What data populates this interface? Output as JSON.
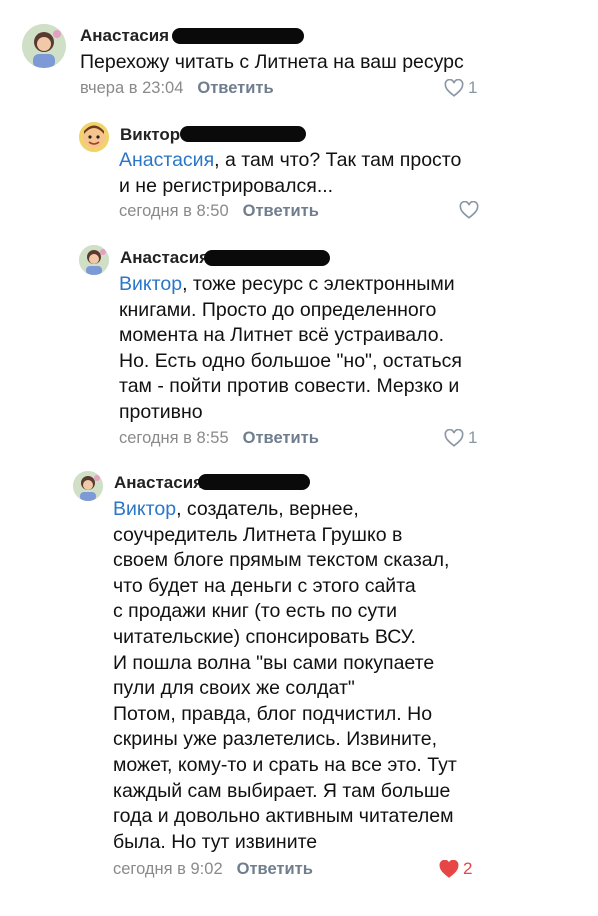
{
  "comments": [
    {
      "author": "Анастасия",
      "lines": [
        "Перехожу читать с Литнета на ваш ресурс"
      ],
      "mention": "",
      "time": "вчера в 23:04",
      "reply_label": "Ответить",
      "likes": "1",
      "liked": false
    },
    {
      "author": "Виктор",
      "mention": "Анастасия",
      "lines": [
        ", а там что? Так там просто",
        "и не регистрировался..."
      ],
      "time": "сегодня в 8:50",
      "reply_label": "Ответить",
      "likes": "",
      "liked": false
    },
    {
      "author": "Анастасия",
      "mention": "Виктор",
      "lines": [
        ", тоже ресурс с электронными",
        "книгами. Просто до определенного",
        "момента на Литнет всё устраивало.",
        "Но. Есть одно большое \"но\", остаться",
        "там - пойти против совести. Мерзко и",
        "противно"
      ],
      "time": "сегодня в 8:55",
      "reply_label": "Ответить",
      "likes": "1",
      "liked": false
    },
    {
      "author": "Анастасия",
      "mention": "Виктор",
      "lines": [
        ", создатель, вернее,",
        "соучредитель Литнета Грушко в",
        "своем блоге прямым текстом сказал,",
        "что будет на деньги с этого сайта",
        "с продажи книг (то есть по сути",
        "читательские) спонсировать ВСУ.",
        "И пошла волна \"вы сами покупаете",
        "пули для своих же солдат\"",
        "Потом, правда, блог подчистил. Но",
        "скрины уже разлетелись. Извините,",
        "может, кому-то и срать на все это. Тут",
        "каждый сам выбирает. Я там больше",
        "года и довольно активным читателем",
        "была. Но тут извините"
      ],
      "time": "сегодня в 9:02",
      "reply_label": "Ответить",
      "likes": "2",
      "liked": true
    }
  ],
  "colors": {
    "mention": "#2a76c8",
    "meta": "#8a8a8a",
    "reply": "#6f7d8e",
    "like_active": "#e64646",
    "like_inactive": "#8a96a3",
    "redaction": "#0a0a0a"
  }
}
